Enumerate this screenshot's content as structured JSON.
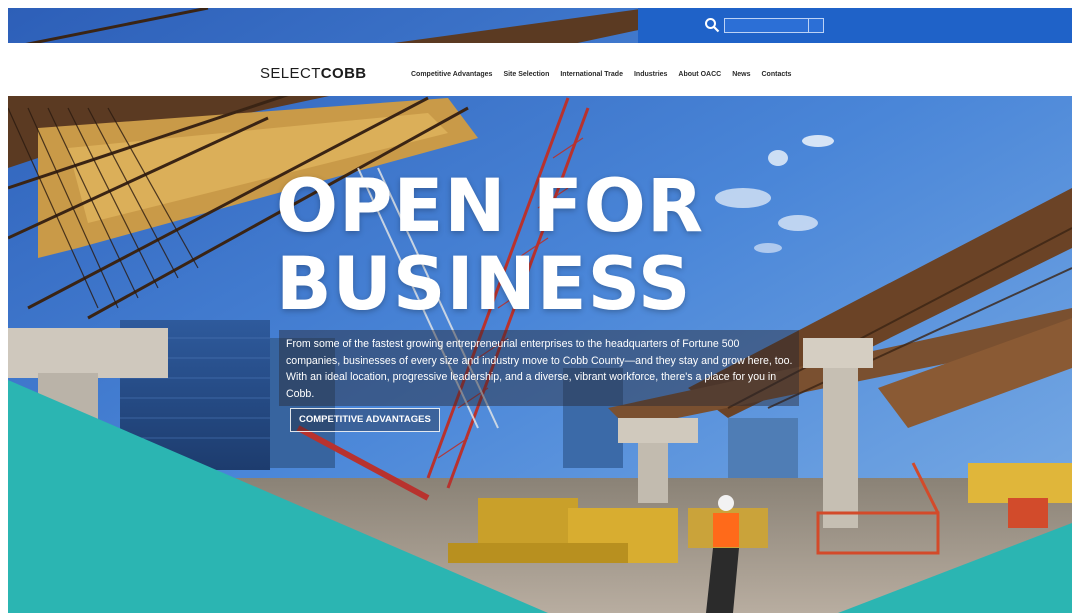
{
  "colors": {
    "utility_blue": "#1f62c8",
    "teal": "#2bb5b2",
    "nav_bg": "#ffffff",
    "headline": "#ffffff"
  },
  "search": {
    "icon": "search-icon",
    "placeholder": ""
  },
  "brand": {
    "logo_part1": "SELECT",
    "logo_part2": "COBB"
  },
  "nav": {
    "items": [
      {
        "label": "Competitive Advantages"
      },
      {
        "label": "Site Selection"
      },
      {
        "label": "International Trade"
      },
      {
        "label": "Industries"
      },
      {
        "label": "About OACC"
      },
      {
        "label": "News"
      },
      {
        "label": "Contacts"
      }
    ]
  },
  "hero": {
    "headline_line1": "OPEN FOR",
    "headline_line2": "BUSINESS",
    "intro": "From some of the fastest growing entrepreneurial enterprises to the headquarters of Fortune 500 companies, businesses of every size and industry move to Cobb County—and they stay and grow here, too. With an ideal location, progressive leadership, and a diverse, vibrant workforce, there's a place for you in Cobb.",
    "cta_label": "COMPETITIVE ADVANTAGES"
  }
}
